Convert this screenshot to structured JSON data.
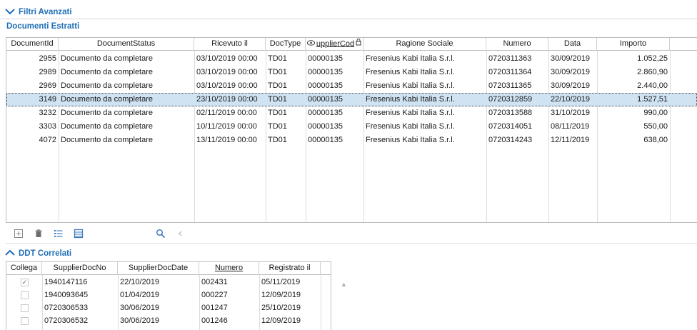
{
  "filters": {
    "label": "Filtri Avanzati"
  },
  "estratti": {
    "title": "Documenti Estratti",
    "columns": [
      {
        "label": "DocumentId"
      },
      {
        "label": "DocumentStatus"
      },
      {
        "label": "Ricevuto il"
      },
      {
        "label": "DocType"
      },
      {
        "label": "upplierCod"
      },
      {
        "label": "Ragione Sociale"
      },
      {
        "label": "Numero"
      },
      {
        "label": "Data"
      },
      {
        "label": "Importo"
      }
    ],
    "rows": [
      {
        "id": "2955",
        "status": "Documento da completare",
        "ricevuto": "03/10/2019 00:00",
        "doctype": "TD01",
        "supplier": "00000135",
        "ragione": "Fresenius Kabi Italia S.r.l.",
        "numero": "0720311363",
        "data": "30/09/2019",
        "importo": "1.052,25"
      },
      {
        "id": "2989",
        "status": "Documento da completare",
        "ricevuto": "03/10/2019 00:00",
        "doctype": "TD01",
        "supplier": "00000135",
        "ragione": "Fresenius Kabi Italia S.r.l.",
        "numero": "0720311364",
        "data": "30/09/2019",
        "importo": "2.860,90"
      },
      {
        "id": "2969",
        "status": "Documento da completare",
        "ricevuto": "03/10/2019 00:00",
        "doctype": "TD01",
        "supplier": "00000135",
        "ragione": "Fresenius Kabi Italia S.r.l.",
        "numero": "0720311365",
        "data": "30/09/2019",
        "importo": "2.440,00"
      },
      {
        "id": "3149",
        "status": "Documento da completare",
        "ricevuto": "23/10/2019 00:00",
        "doctype": "TD01",
        "supplier": "00000135",
        "ragione": "Fresenius Kabi Italia S.r.l.",
        "numero": "0720312859",
        "data": "22/10/2019",
        "importo": "1.527,51",
        "selected": true
      },
      {
        "id": "3232",
        "status": "Documento da completare",
        "ricevuto": "02/11/2019 00:00",
        "doctype": "TD01",
        "supplier": "00000135",
        "ragione": "Fresenius Kabi Italia S.r.l.",
        "numero": "0720313588",
        "data": "31/10/2019",
        "importo": "990,00"
      },
      {
        "id": "3303",
        "status": "Documento da completare",
        "ricevuto": "10/11/2019 00:00",
        "doctype": "TD01",
        "supplier": "00000135",
        "ragione": "Fresenius Kabi Italia S.r.l.",
        "numero": "0720314051",
        "data": "08/11/2019",
        "importo": "550,00"
      },
      {
        "id": "4072",
        "status": "Documento da completare",
        "ricevuto": "13/11/2019 00:00",
        "doctype": "TD01",
        "supplier": "00000135",
        "ragione": "Fresenius Kabi Italia S.r.l.",
        "numero": "0720314243",
        "data": "12/11/2019",
        "importo": "638,00"
      }
    ]
  },
  "toolbar": {
    "icons": [
      "add-icon",
      "delete-icon",
      "list-details-icon",
      "table-icon",
      "search-icon",
      "chevron-left-icon"
    ]
  },
  "ddt": {
    "title": "DDT Correlati",
    "columns": [
      {
        "label": "Collega"
      },
      {
        "label": "SupplierDocNo"
      },
      {
        "label": "SupplierDocDate"
      },
      {
        "label": "Numero"
      },
      {
        "label": "Registrato il"
      }
    ],
    "rows": [
      {
        "checked": true,
        "docno": "1940147116",
        "docdate": "22/10/2019",
        "numero": "002431",
        "registrato": "05/11/2019"
      },
      {
        "checked": false,
        "docno": "1940093645",
        "docdate": "01/04/2019",
        "numero": "000227",
        "registrato": "12/09/2019"
      },
      {
        "checked": false,
        "docno": "0720306533",
        "docdate": "30/06/2019",
        "numero": "001247",
        "registrato": "25/10/2019"
      },
      {
        "checked": false,
        "docno": "0720306532",
        "docdate": "30/06/2019",
        "numero": "001246",
        "registrato": "12/09/2019"
      }
    ]
  },
  "colors": {
    "accent": "#1f6fb5",
    "selection": "#cfe3f3"
  }
}
